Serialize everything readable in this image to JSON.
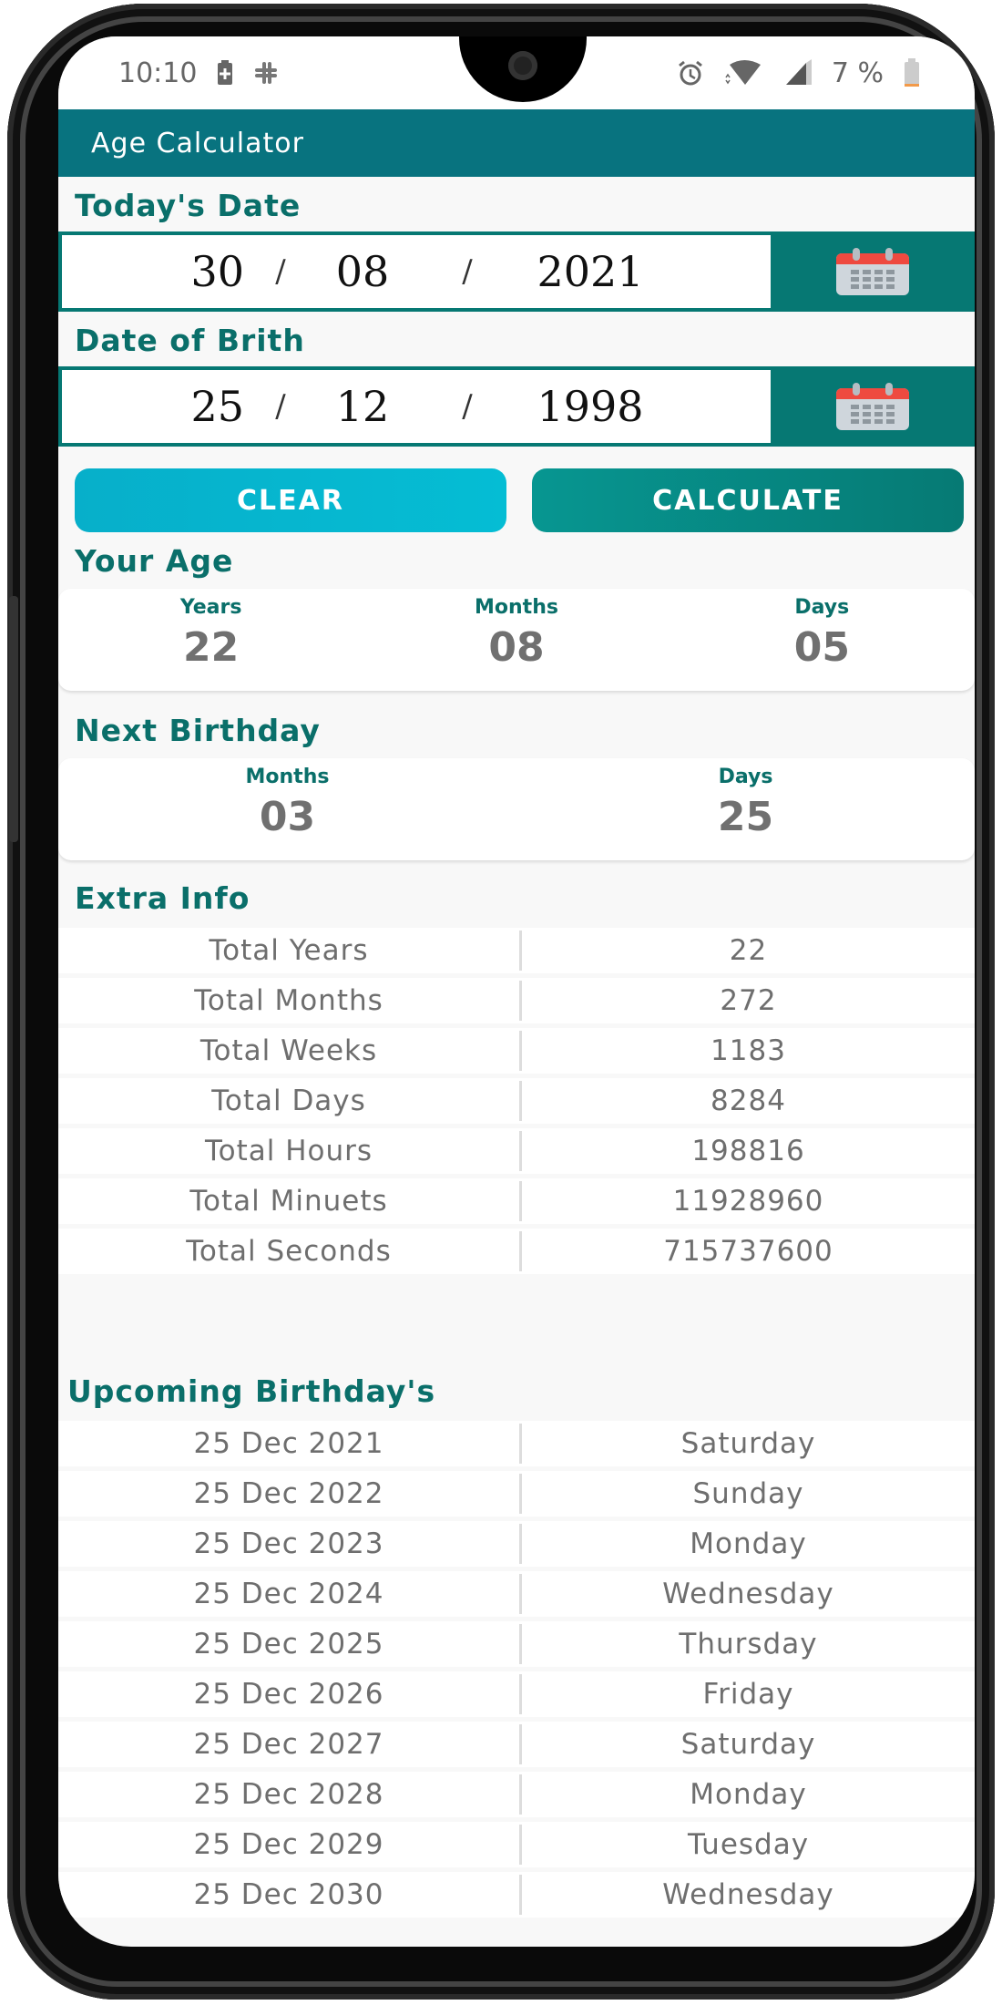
{
  "status_bar": {
    "time": "10:10",
    "left_icons": [
      "battery-saver-icon",
      "slack-icon"
    ],
    "right_icons": [
      "alarm-icon",
      "wifi-icon",
      "signal-icon"
    ],
    "battery_percent": "7 %"
  },
  "app_bar": {
    "title": "Age Calculator"
  },
  "today": {
    "label": "Today's Date",
    "day": "30",
    "month": "08",
    "year": "2021",
    "sep": "/"
  },
  "birth": {
    "label": "Date of Brith",
    "day": "25",
    "month": "12",
    "year": "1998",
    "sep": "/"
  },
  "buttons": {
    "clear": "CLEAR",
    "calculate": "CALCULATE"
  },
  "your_age": {
    "title": "Your Age",
    "years_label": "Years",
    "years": "22",
    "months_label": "Months",
    "months": "08",
    "days_label": "Days",
    "days": "05"
  },
  "next_birthday": {
    "title": "Next Birthday",
    "months_label": "Months",
    "months": "03",
    "days_label": "Days",
    "days": "25"
  },
  "extra_info": {
    "title": "Extra Info",
    "rows": [
      {
        "label": "Total Years",
        "value": "22"
      },
      {
        "label": "Total Months",
        "value": "272"
      },
      {
        "label": "Total Weeks",
        "value": "1183"
      },
      {
        "label": "Total Days",
        "value": "8284"
      },
      {
        "label": "Total Hours",
        "value": "198816"
      },
      {
        "label": "Total Minuets",
        "value": "11928960"
      },
      {
        "label": "Total Seconds",
        "value": "715737600"
      }
    ]
  },
  "upcoming": {
    "title": "Upcoming Birthday's",
    "rows": [
      {
        "date": "25 Dec 2021",
        "day": "Saturday"
      },
      {
        "date": "25 Dec 2022",
        "day": "Sunday"
      },
      {
        "date": "25 Dec 2023",
        "day": "Monday"
      },
      {
        "date": "25 Dec 2024",
        "day": "Wednesday"
      },
      {
        "date": "25 Dec 2025",
        "day": "Thursday"
      },
      {
        "date": "25 Dec 2026",
        "day": "Friday"
      },
      {
        "date": "25 Dec 2027",
        "day": "Saturday"
      },
      {
        "date": "25 Dec 2028",
        "day": "Monday"
      },
      {
        "date": "25 Dec 2029",
        "day": "Tuesday"
      },
      {
        "date": "25 Dec 2030",
        "day": "Wednesday"
      }
    ]
  },
  "colors": {
    "app_bar": "#08737f",
    "accent_teal": "#0a6f6a",
    "date_frame": "#067873",
    "clear_button": "#05bdd4",
    "calculate_button": "#067a74",
    "value_gray": "#707070"
  }
}
